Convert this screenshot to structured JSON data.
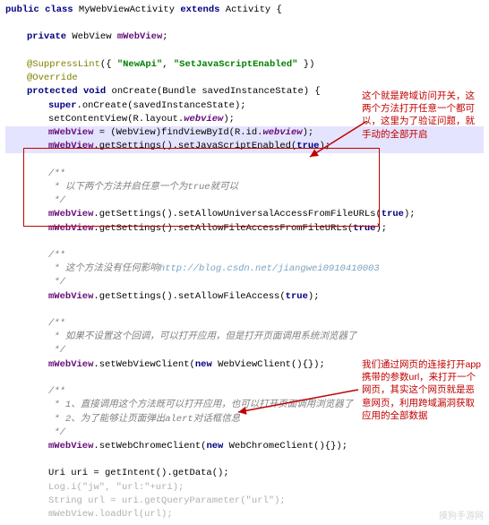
{
  "c": {
    "l1_pre": "public class ",
    "l1_name": "MyWebViewActivity ",
    "l1_ext": "extends ",
    "l1_sup": "Activity {",
    "l2_pre": "private ",
    "l2_type": "WebView ",
    "l2_var": "mWebView",
    "l2_end": ";",
    "l3_at": "@SuppressLint",
    "l3_args": "({ ",
    "l3_s1": "\"NewApi\"",
    "l3_c": ", ",
    "l3_s2": "\"SetJavaScriptEnabled\"",
    "l3_end": " })",
    "l4": "@Override",
    "l5_pre": "protected void ",
    "l5_name": "onCreate",
    "l5_args": "(Bundle savedInstanceState) {",
    "l6_pre": "super",
    "l6_rest": ".onCreate(savedInstanceState);",
    "l7_a": "setContentView(R.layout.",
    "l7_b": "webview",
    "l7_c": ");",
    "l8_a": "mWebView",
    "l8_b": " = (WebView)findViewById(R.id.",
    "l8_c": "webview",
    "l8_d": ");",
    "l9_a": "mWebView",
    "l9_b": ".getSettings().setJavaScriptEnabled(",
    "l9_c": "true",
    "l9_d": ");",
    "cm1a": "/**",
    "cm1b": " * 以下两个方法并启任意一个为true就可以",
    "cm1c": " */",
    "l10_a": "mWebView",
    "l10_b": ".getSettings().setAllowUniversalAccessFromFileURLs(",
    "l10_c": "true",
    "l10_d": ");",
    "l11_a": "mWebView",
    "l11_b": ".getSettings().setAllowFileAccessFromFileURLs(",
    "l11_c": "true",
    "l11_d": ");",
    "cm2a": "/**",
    "cm2b": " * 这个方法没有任何影响",
    "cm2c": " */",
    "wm1": "http://blog.csdn.net/jiangwei0910410003",
    "l12_a": "mWebView",
    "l12_b": ".getSettings().setAllowFileAccess(",
    "l12_c": "true",
    "l12_d": ");",
    "cm3a": "/**",
    "cm3b": " * 如果不设置这个回调，可以打开应用，但是打开页面调用系统浏览器了",
    "cm3c": " */",
    "l13_a": "mWebView",
    "l13_b": ".setWebViewClient(",
    "l13_c": "new ",
    "l13_d": "WebViewClient(){});",
    "cm4a": "/**",
    "cm4b": " * 1、直接调用这个方法既可以打开应用，也可以打开页面调用浏览器了",
    "cm4c": " * 2、为了能够让页面弹出alert对话框信息",
    "cm4d": " */",
    "l14_a": "mWebView",
    "l14_b": ".setWebChromeClient(",
    "l14_c": "new ",
    "l14_d": "WebChromeClient(){});",
    "l15": "Uri uri = getIntent().getData();",
    "l16_a": "Log.",
    "l16_b": "i",
    "l16_c": "(",
    "l16_d": "\"jw\"",
    "l16_e": ", ",
    "l16_f": "\"url:\"",
    "l16_g": "+uri);",
    "l17_a": "String url = uri.getQueryParameter(",
    "l17_b": "\"url\"",
    "l17_c": ");",
    "l18": "mWebView.loadUrl(url);"
  },
  "annotations": {
    "a1": "这个就是跨域访问开关，这两个方法打开任意一个都可以，这里为了验证问题，就手动的全部开启",
    "a2": "我们通过网页的连接打开app携带的参数url，来打开一个网页，其实这个网页就是恶意网页，利用跨域漏洞获取应用的全部数据"
  },
  "watermark": "摸狗手游网"
}
